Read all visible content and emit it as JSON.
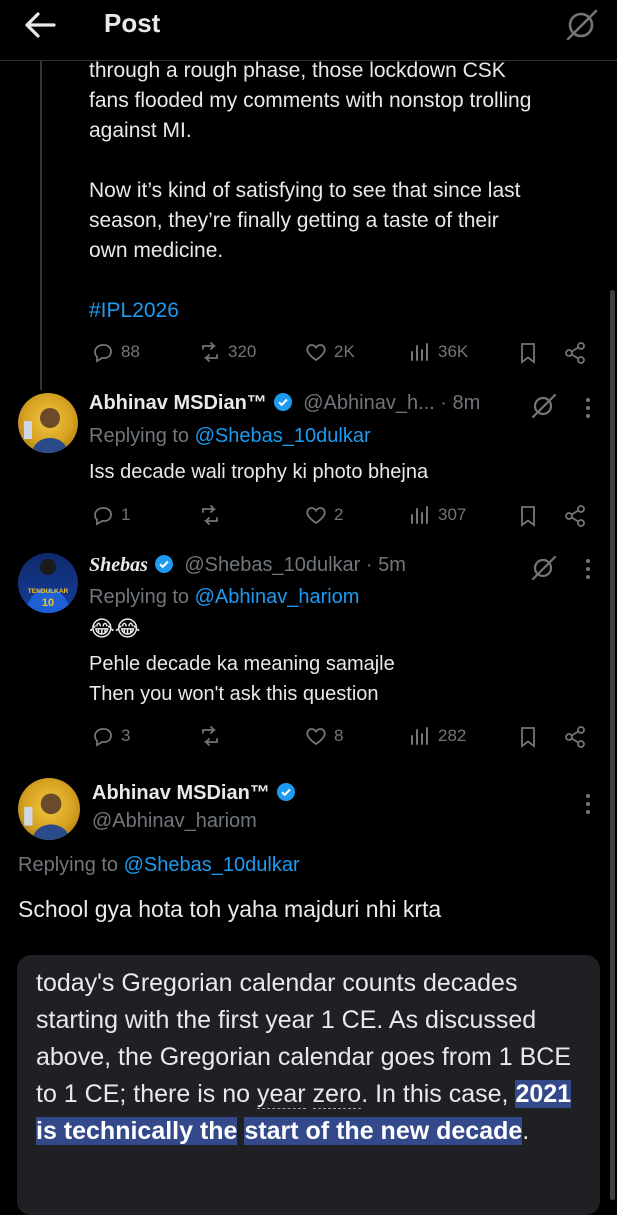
{
  "header": {
    "title": "Post"
  },
  "main_post": {
    "text_line1": "through a rough phase, those lockdown CSK",
    "text_line2": "fans flooded my comments with nonstop trolling",
    "text_line3": "against MI.",
    "text_line4": "Now it’s kind of satisfying to see that since last",
    "text_line5": "season, they’re finally getting a taste of their",
    "text_line6": "own medicine.",
    "hashtag": "#IPL2026",
    "stats": {
      "replies": "88",
      "reposts": "320",
      "likes": "2K",
      "views": "36K"
    }
  },
  "reply1": {
    "name": "Abhinav MSDian™",
    "handle_time": "@Abhinav_h... · 8m",
    "replying_prefix": "Replying to",
    "replying_to": "@Shebas_10dulkar",
    "text": "Iss decade wali trophy ki photo bhejna",
    "stats": {
      "replies": "1",
      "reposts": "",
      "likes": "2",
      "views": "307"
    }
  },
  "reply2": {
    "name": "Shebas",
    "handle_time": "@Shebas_10dulkar · 5m",
    "replying_prefix": "Replying to",
    "replying_to": "@Abhinav_hariom",
    "emoji": "😂😂",
    "text_line1": "Pehle decade ka meaning samajle",
    "text_line2": "Then you won't ask this question",
    "avatar_text_top": "TENDULKAR",
    "avatar_text_num": "10",
    "stats": {
      "replies": "3",
      "reposts": "",
      "likes": "8",
      "views": "282"
    }
  },
  "focus_post": {
    "name": "Abhinav MSDian™",
    "handle": "@Abhinav_hariom",
    "replying_prefix": "Replying to",
    "replying_to": "@Shebas_10dulkar",
    "text": "School gya hota toh yaha majduri nhi krta"
  },
  "quoted_image": {
    "part1": "today's Gregorian calendar counts decades starting with the first year 1 CE. As discussed above, the Gregorian calendar goes from 1 BCE to 1 CE; there is no ",
    "dotted1": "year",
    "part2": " ",
    "dotted2": "zero",
    "part3": ". In this case, ",
    "highlight1": "2021 is technically the",
    "highlight2": "start of the new decade",
    "end": "."
  },
  "colors": {
    "accent": "#1d9bf0",
    "muted": "#71767b",
    "highlight": "#33498a"
  }
}
